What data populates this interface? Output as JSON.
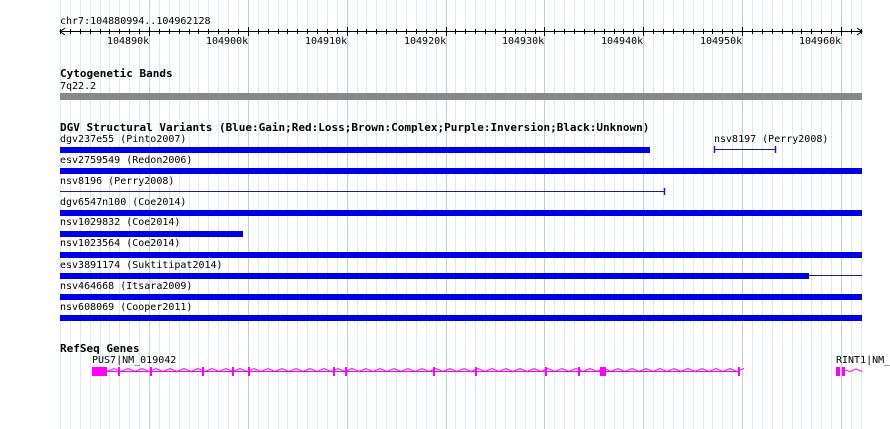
{
  "view": {
    "start": 104880994,
    "end": 104962128
  },
  "ruler": {
    "label": "chr7:104880994..104962128",
    "ticks": [
      {
        "pos": 104890000,
        "label": "104890k"
      },
      {
        "pos": 104900000,
        "label": "104900k"
      },
      {
        "pos": 104910000,
        "label": "104910k"
      },
      {
        "pos": 104920000,
        "label": "104920k"
      },
      {
        "pos": 104930000,
        "label": "104930k"
      },
      {
        "pos": 104940000,
        "label": "104940k"
      },
      {
        "pos": 104950000,
        "label": "104950k"
      },
      {
        "pos": 104960000,
        "label": "104960k"
      }
    ]
  },
  "cyto": {
    "title": "Cytogenetic Bands",
    "band": "7q22.2"
  },
  "dgv": {
    "title": "DGV Structural Variants (Blue:Gain;Red:Loss;Brown:Complex;Purple:Inversion;Black:Unknown)",
    "colors": {
      "gain": "#0000e6",
      "line": "#1a1aa8"
    },
    "variants": [
      {
        "label": "dgv237e55 (Pinto2007)",
        "start": 104880994,
        "end": 104940700,
        "style": "thick"
      },
      {
        "label": "nsv8197 (Perry2008)",
        "start": 104947200,
        "end": 104953300,
        "style": "thin"
      },
      {
        "label": "esv2759549 (Redon2006)",
        "start": 104880994,
        "end": 104962128,
        "style": "thick"
      },
      {
        "label": "nsv8196 (Perry2008)",
        "start": 104880994,
        "end": 104942100,
        "style": "thin"
      },
      {
        "label": "dgv6547n100 (Coe2014)",
        "start": 104880994,
        "end": 104962128,
        "style": "thick"
      },
      {
        "label": "nsv1029832 (Coe2014)",
        "start": 104880994,
        "end": 104899500,
        "style": "thick"
      },
      {
        "label": "nsv1023564 (Coe2014)",
        "start": 104880994,
        "end": 104962128,
        "style": "thick"
      },
      {
        "label": "esv3891174 (Suktitipat2014)",
        "start": 104880994,
        "end": 104956800,
        "style": "thick-tail"
      },
      {
        "label": "nsv464668 (Itsara2009)",
        "start": 104880994,
        "end": 104962128,
        "style": "thick"
      },
      {
        "label": "nsv608069 (Cooper2011)",
        "start": 104880994,
        "end": 104962128,
        "style": "thick"
      }
    ]
  },
  "genes": {
    "title": "RefSeq Genes",
    "color": "#ff00ff",
    "items": [
      {
        "label": "PUS7|NM_019042"
      },
      {
        "label": "RINT1|NM_"
      }
    ]
  }
}
